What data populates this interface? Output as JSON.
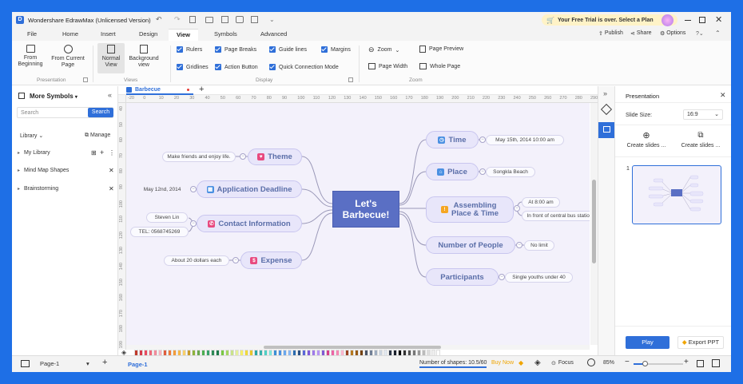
{
  "app": {
    "title": "Wondershare EdrawMax (Unlicensed Version)",
    "trial_banner": "Your Free Trial is over. Select a Plan"
  },
  "menu": {
    "items": [
      "File",
      "Home",
      "Insert",
      "Design",
      "View",
      "Symbols",
      "Advanced"
    ],
    "active": "View",
    "right": {
      "publish": "Publish",
      "share": "Share",
      "options": "Options"
    }
  },
  "ribbon": {
    "presentation": {
      "from_beginning": [
        "From",
        "Beginning"
      ],
      "from_current": [
        "From Current",
        "Page"
      ],
      "group": "Presentation"
    },
    "views": {
      "normal": [
        "Normal",
        "View"
      ],
      "background": [
        "Background",
        "view"
      ],
      "group": "Views"
    },
    "display": {
      "rulers": "Rulers",
      "page_breaks": "Page Breaks",
      "guide_lines": "Guide lines",
      "margins": "Margins",
      "gridlines": "Gridlines",
      "action_button": "Action Button",
      "quick_connection": "Quick Connection Mode",
      "group": "Display"
    },
    "zoom": {
      "zoom": "Zoom",
      "page_preview": "Page Preview",
      "page_width": "Page Width",
      "whole_page": "Whole Page",
      "group": "Zoom"
    }
  },
  "left_panel": {
    "title": "More Symbols",
    "search_placeholder": "Search",
    "search_button": "Search",
    "library_label": "Library",
    "manage": "Manage",
    "items": [
      "My Library",
      "Mind Map Shapes",
      "Brainstorming"
    ]
  },
  "document": {
    "tab": "Barbecue"
  },
  "ruler": {
    "top": [
      "-20",
      "0",
      "10",
      "20",
      "30",
      "40",
      "50",
      "60",
      "70",
      "80",
      "90",
      "100",
      "110",
      "120",
      "130",
      "140",
      "150",
      "160",
      "170",
      "180",
      "190",
      "200",
      "210",
      "220",
      "230",
      "240",
      "250",
      "260",
      "270",
      "280",
      "290"
    ],
    "left": [
      "40",
      "50",
      "60",
      "70",
      "80",
      "90",
      "100",
      "110",
      "120",
      "130",
      "140",
      "150",
      "160",
      "170",
      "180",
      "190"
    ]
  },
  "mindmap": {
    "center": [
      "Let's",
      "Barbecue!"
    ],
    "left": [
      {
        "label": "Theme",
        "icon": "heart-icon",
        "color": "#e84a7f",
        "leaves": [
          "Make friends and enjoy life."
        ]
      },
      {
        "label": "Application Deadline",
        "icon": "calendar-icon",
        "color": "#4a90e2",
        "leaves": [
          "May 12nd, 2014"
        ]
      },
      {
        "label": "Contact Information",
        "icon": "phone-icon",
        "color": "#e84a7f",
        "leaves": [
          "Steven Lin",
          "TEL: 0568745269"
        ]
      },
      {
        "label": "Expense",
        "icon": "dollar-icon",
        "color": "#e84a7f",
        "leaves": [
          "About 20 dollars each"
        ]
      }
    ],
    "right": [
      {
        "label": "Time",
        "icon": "clock-icon",
        "color": "#4a90e2",
        "leaves": [
          "May 15th, 2014   10:00 am"
        ]
      },
      {
        "label": "Place",
        "icon": "location-icon",
        "color": "#4a90e2",
        "leaves": [
          "Songkla Beach"
        ]
      },
      {
        "label": [
          "Assembling",
          "Place & Time"
        ],
        "icon": "warning-icon",
        "color": "#f5a623",
        "leaves": [
          "At 8:00 am",
          "In front of central bus station"
        ]
      },
      {
        "label": "Number of People",
        "leaves": [
          "No limit"
        ]
      },
      {
        "label": "Participants",
        "leaves": [
          "Single youths under 40"
        ]
      }
    ]
  },
  "right_panel": {
    "title": "Presentation",
    "slide_size_label": "Slide Size:",
    "slide_size_value": "16:9",
    "create1": "Create slides ...",
    "create2": "Create slides ...",
    "slide_number": "1",
    "play": "Play",
    "export": "Export PPT"
  },
  "status": {
    "page_select": "Page-1",
    "page_tab": "Page-1",
    "shapes": "Number of shapes: 10.5/60",
    "buy_now": "Buy Now",
    "focus": "Focus",
    "zoom": "85%"
  },
  "palette": [
    "#c0392b",
    "#d63a4a",
    "#e84a5f",
    "#ee6a7a",
    "#f28b9a",
    "#f7b3bd",
    "#e05c3c",
    "#ee7a3a",
    "#f39c3a",
    "#f5b84a",
    "#f8d06a",
    "#c89a2a",
    "#8db33a",
    "#6aa84f",
    "#4caf50",
    "#38a169",
    "#2e8b57",
    "#1e7a4a",
    "#7ac943",
    "#a4d65e",
    "#c8e28a",
    "#e4ef9a",
    "#f4ee6a",
    "#f1da3a",
    "#e8c62a",
    "#2aa6a4",
    "#38b2ac",
    "#4fd1c5",
    "#81e6d9",
    "#3a8fd6",
    "#4a90e2",
    "#6aa8ee",
    "#8ab8f2",
    "#2b6cb0",
    "#2c5282",
    "#5a67d8",
    "#7f5ad8",
    "#9f7aea",
    "#b794f4",
    "#805ad5",
    "#d53f8c",
    "#ed64a6",
    "#f687b3",
    "#fbb6ce",
    "#9c4221",
    "#b7791f",
    "#975a16",
    "#744210",
    "#4a5568",
    "#718096",
    "#a0aec0",
    "#cbd5e0",
    "#e2e8f0",
    "#2d3748",
    "#1a202c",
    "#000000",
    "#333333",
    "#555555",
    "#777777",
    "#999999",
    "#bbbbbb",
    "#dddddd",
    "#eeeeee",
    "#ffffff"
  ]
}
